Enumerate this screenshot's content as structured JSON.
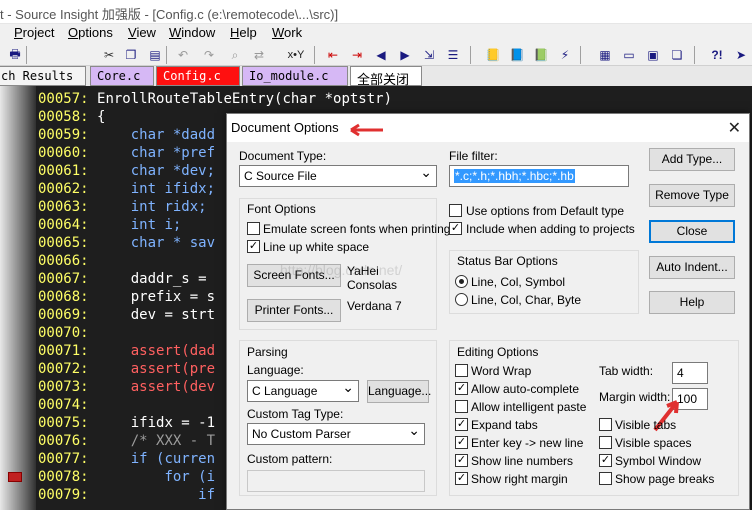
{
  "titlebar": {
    "text": "t - Source Insight 加强版 - [Config.c (e:\\remotecode\\...\\src)]"
  },
  "menu": [
    "Project",
    "Options",
    "View",
    "Window",
    "Help",
    "Work"
  ],
  "toolbar": {
    "icons": [
      "print-icon",
      "cut-icon",
      "copy-icon",
      "paste-icon",
      "xy-icon",
      "bookmark-left-icon",
      "bookmark-right-icon",
      "back-icon",
      "forward-icon",
      "jump-icon",
      "list-icon",
      "book-icon",
      "book2-icon",
      "book3-icon",
      "lookup-icon",
      "window-tile-icon",
      "window-left-icon",
      "window-right-icon",
      "window-cascade-icon",
      "help-icon",
      "pointer-icon"
    ],
    "xy_label": "x•Y"
  },
  "tabs": [
    {
      "label": "ch Results"
    },
    {
      "label": "Core.c"
    },
    {
      "label": "Config.c"
    },
    {
      "label": "Io_module.c"
    },
    {
      "label": "全部关闭"
    }
  ],
  "code": [
    {
      "ln": "00057:",
      "text": "EnrollRouteTableEntry(char *optstr)"
    },
    {
      "ln": "00058:",
      "text": "{"
    },
    {
      "ln": "00059:",
      "text": "    char *dadd"
    },
    {
      "ln": "00060:",
      "text": "    char *pref"
    },
    {
      "ln": "00061:",
      "text": "    char *dev;"
    },
    {
      "ln": "00062:",
      "text": "    int ifidx;"
    },
    {
      "ln": "00063:",
      "text": "    int ridx;"
    },
    {
      "ln": "00064:",
      "text": "    int i;"
    },
    {
      "ln": "00065:",
      "text": "    char * sav"
    },
    {
      "ln": "00066:",
      "text": ""
    },
    {
      "ln": "00067:",
      "text": "    daddr_s = "
    },
    {
      "ln": "00068:",
      "text": "    prefix = s"
    },
    {
      "ln": "00069:",
      "text": "    dev = strt"
    },
    {
      "ln": "00070:",
      "text": ""
    },
    {
      "ln": "00071:",
      "text": "    assert(dad"
    },
    {
      "ln": "00072:",
      "text": "    assert(pre"
    },
    {
      "ln": "00073:",
      "text": "    assert(dev"
    },
    {
      "ln": "00074:",
      "text": ""
    },
    {
      "ln": "00075:",
      "text": "    ifidx = -1"
    },
    {
      "ln": "00076:",
      "text": "    /* XXX - T"
    },
    {
      "ln": "00077:",
      "text": "    if (curren"
    },
    {
      "ln": "00078:",
      "text": "        for (i"
    },
    {
      "ln": "00079:",
      "text": "            if"
    }
  ],
  "dialog": {
    "title": "Document Options",
    "document_type_label": "Document Type:",
    "document_type_value": "C Source File",
    "file_filter_label": "File filter:",
    "file_filter_value": "*.c;*.h;*.hbh;*.hbc;*.hb",
    "font_options_label": "Font Options",
    "emulate_label": "Emulate screen fonts when printing",
    "lineup_label": "Line up white space",
    "screen_fonts_button": "Screen Fonts...",
    "screen_fonts_value1": "YaHei",
    "screen_fonts_value2": "Consolas",
    "printer_fonts_button": "Printer Fonts...",
    "printer_fonts_value": "Verdana 7",
    "use_default_label": "Use options from Default type",
    "include_window_label": "Include when adding to projects",
    "status_bar_label": "Status Bar Options",
    "status_opt1": "Line, Col, Symbol",
    "status_opt2": "Line, Col, Char, Byte",
    "add_type_button": "Add Type...",
    "remove_type_button": "Remove Type",
    "close_button": "Close",
    "auto_indent_button": "Auto Indent...",
    "help_button": "Help",
    "parsing_label": "Parsing",
    "language_label": "Language:",
    "language_value": "C Language",
    "language_button": "Language...",
    "custom_tag_label": "Custom Tag Type:",
    "custom_tag_value": "No Custom Parser",
    "custom_pattern_label": "Custom pattern:",
    "editing_label": "Editing Options",
    "word_wrap": "Word Wrap",
    "allow_autocomplete": "Allow auto-complete",
    "allow_paste": "Allow intelligent paste",
    "expand_tabs": "Expand tabs",
    "enter_key": "Enter key -> new line",
    "show_line_numbers": "Show line numbers",
    "show_right_margin": "Show right margin",
    "tab_width_label": "Tab width:",
    "tab_width_value": "4",
    "margin_width_label": "Margin width:",
    "margin_width_value": "100",
    "visible_tabs": "Visible tabs",
    "visible_spaces": "Visible spaces",
    "symbol_window": "Symbol Window",
    "show_page_breaks": "Show page breaks"
  },
  "watermark": "http://blog.csdn.net/",
  "colors": {
    "accent": "#0078d7",
    "tab_red": "#ff0000",
    "tab_purple": "#c8a0f0",
    "arrow": "#e03030"
  }
}
